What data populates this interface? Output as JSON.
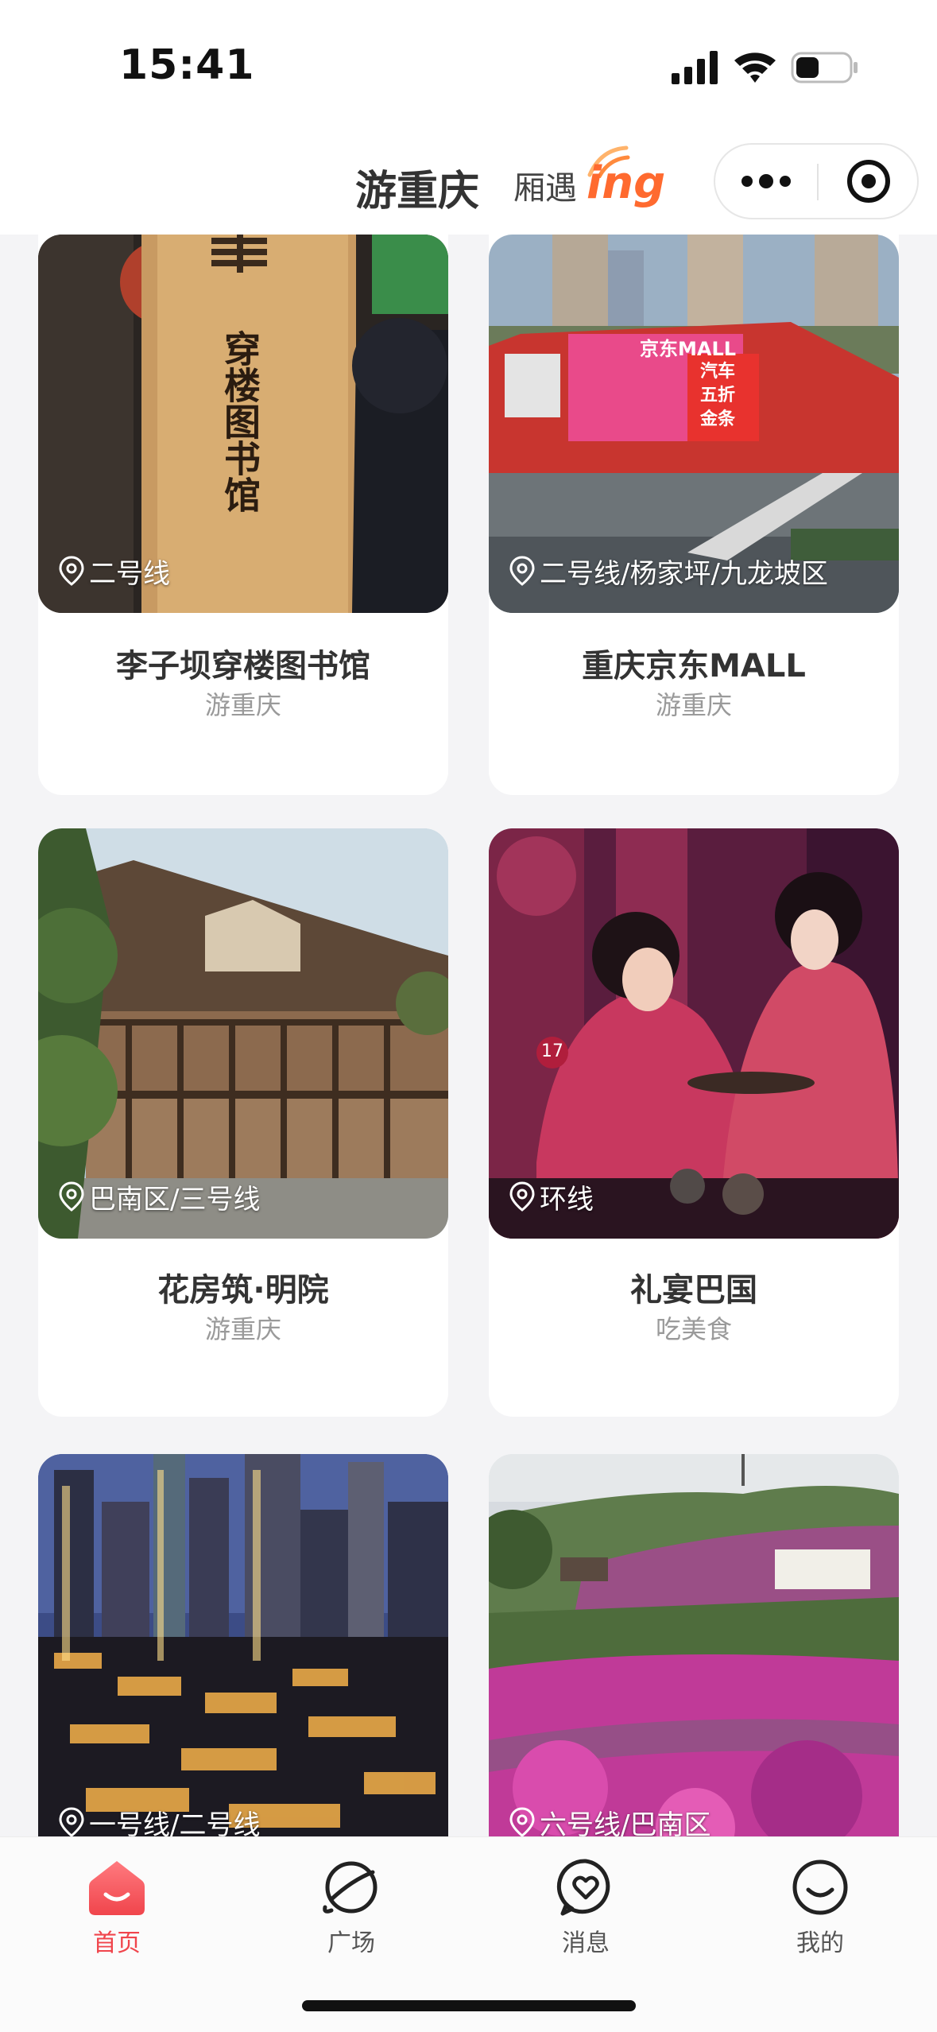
{
  "status_bar": {
    "time": "15:41"
  },
  "header": {
    "title": "游重庆",
    "brand_text": "厢遇",
    "brand_ing": "ing"
  },
  "colors": {
    "accent": "#f0454c",
    "brand_orange": "#ff6a2f"
  },
  "cards": [
    {
      "location": "二号线",
      "title": "李子坝穿楼图书馆",
      "subtitle": "游重庆",
      "sign_text": "穿楼图书馆"
    },
    {
      "location": "二号线/杨家坪/九龙坡区",
      "title": "重庆京东MALL",
      "subtitle": "游重庆",
      "mall_sign": "京东MALL",
      "promo_lines": [
        "汽车",
        "五折",
        "金条"
      ]
    },
    {
      "location": "巴南区/三号线",
      "title": "花房筑·明院",
      "subtitle": "游重庆"
    },
    {
      "location": "环线",
      "title": "礼宴巴国",
      "subtitle": "吃美食",
      "table_number": "17"
    },
    {
      "location": "一号线/二号线",
      "title": "",
      "subtitle": ""
    },
    {
      "location": "六号线/巴南区",
      "title": "",
      "subtitle": ""
    }
  ],
  "tabs": [
    {
      "label": "首页",
      "icon": "home-icon",
      "active": true
    },
    {
      "label": "广场",
      "icon": "planet-icon",
      "active": false
    },
    {
      "label": "消息",
      "icon": "message-heart-icon",
      "active": false
    },
    {
      "label": "我的",
      "icon": "smile-face-icon",
      "active": false
    }
  ]
}
